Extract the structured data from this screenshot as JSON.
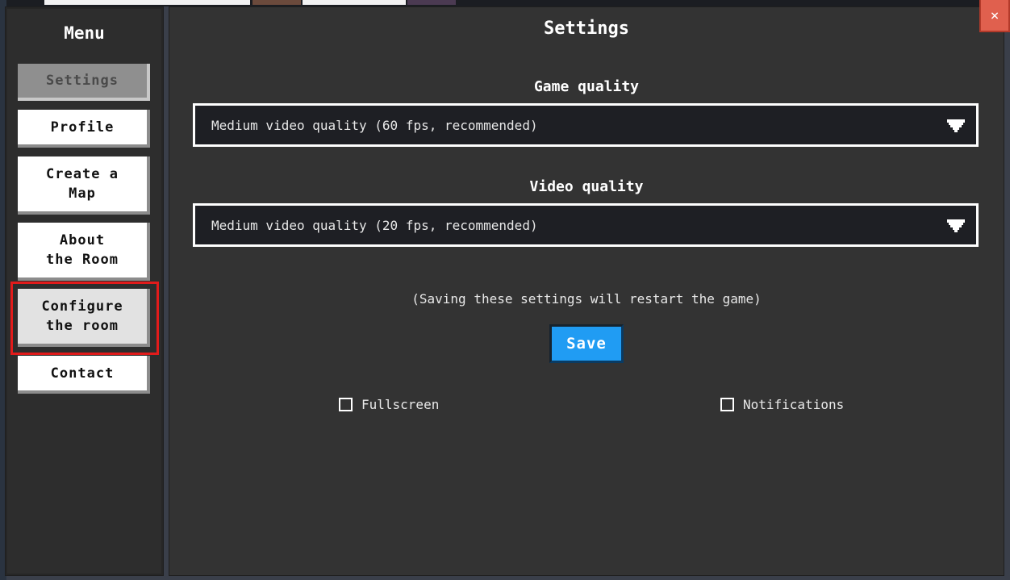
{
  "menu": {
    "title": "Menu",
    "items": [
      {
        "label": "Settings"
      },
      {
        "label": "Profile"
      },
      {
        "label": "Create a\nMap"
      },
      {
        "label": "About\nthe Room"
      },
      {
        "label": "Configure\nthe room"
      },
      {
        "label": "Contact"
      }
    ]
  },
  "settings": {
    "title": "Settings",
    "game_quality": {
      "label": "Game quality",
      "selected": "Medium video quality (60 fps, recommended)"
    },
    "video_quality": {
      "label": "Video quality",
      "selected": "Medium video quality (20 fps, recommended)"
    },
    "note": "(Saving these settings will restart the game)",
    "save_label": "Save",
    "fullscreen_label": "Fullscreen",
    "notifications_label": "Notifications"
  },
  "close_label": "×",
  "colors": {
    "accent": "#209cf3",
    "highlight": "#e11b1b",
    "close": "#e0604e"
  }
}
